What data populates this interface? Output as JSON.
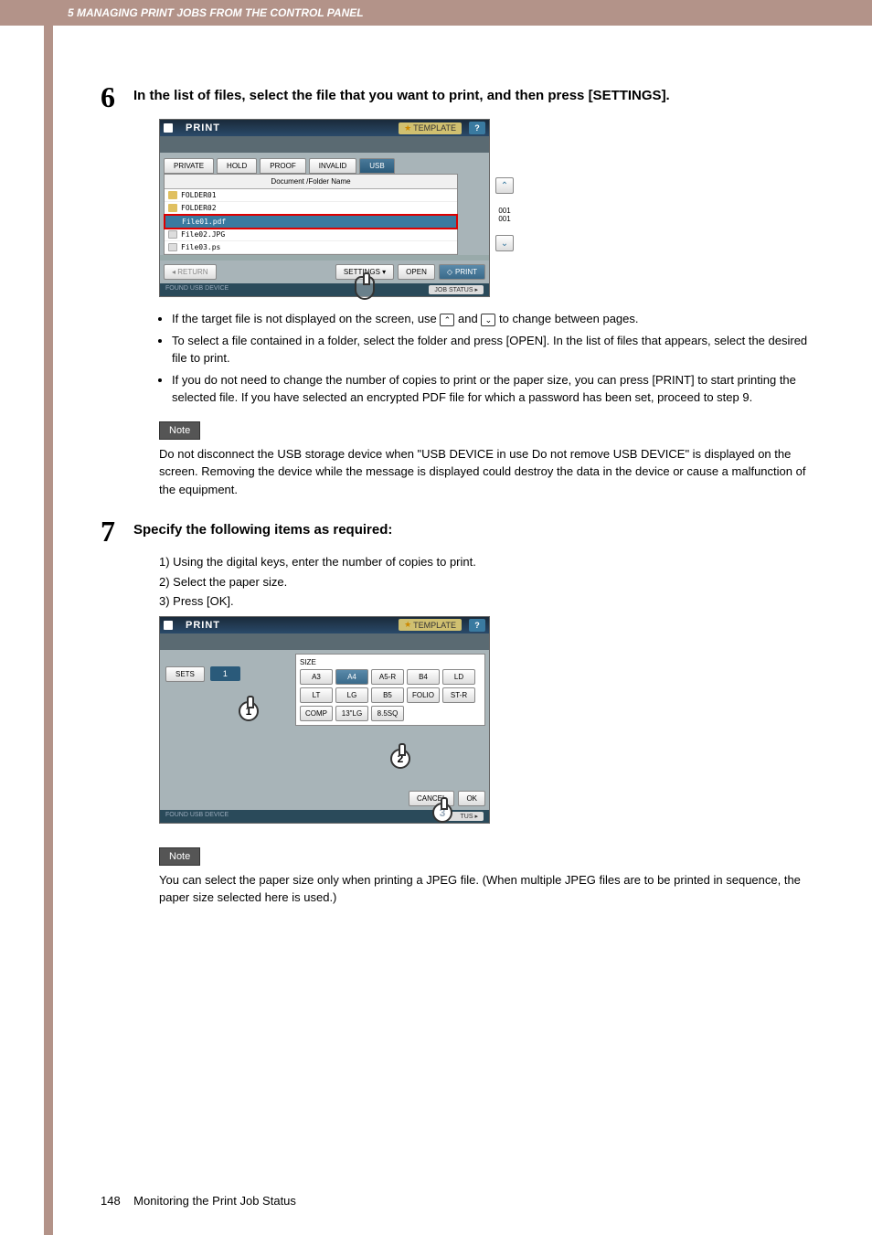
{
  "header": "5 MANAGING PRINT JOBS FROM THE CONTROL PANEL",
  "step6": {
    "num": "6",
    "title": "In the list of files, select the file that you want to print, and then press [SETTINGS].",
    "screen": {
      "title": "PRINT",
      "template": "TEMPLATE",
      "help": "?",
      "tabs": [
        "PRIVATE",
        "HOLD",
        "PROOF",
        "INVALID",
        "USB"
      ],
      "active_tab": "USB",
      "list_header": "Document /Folder Name",
      "files": [
        "FOLDER01",
        "FOLDER02",
        "File01.pdf",
        "File02.JPG",
        "File03.ps"
      ],
      "selected": "File01.pdf",
      "page": "001",
      "page_total": "001",
      "return": "RETURN",
      "settings": "SETTINGS",
      "open": "OPEN",
      "print": "PRINT",
      "status_left": "FOUND USB DEVICE",
      "status_right": "JOB STATUS"
    },
    "bullets": [
      "If the target file is not displayed on the screen, use",
      "and",
      "to change between pages.",
      "To select a file contained in a folder, select the folder and press [OPEN]. In the list of files that appears, select the desired file to print.",
      "If you do not need to change the number of copies to print or the paper size, you can press [PRINT] to start printing the selected file. If you have selected an encrypted PDF file for which a password has been set, proceed to step 9."
    ],
    "note_label": "Note",
    "note": "Do not disconnect the USB storage device when \"USB DEVICE in use Do not remove USB DEVICE\" is displayed on the screen. Removing the device while the message is displayed could destroy the data in the device or cause a malfunction of the equipment."
  },
  "step7": {
    "num": "7",
    "title": "Specify the following items as required:",
    "items": [
      "1)  Using the digital keys, enter the number of copies to print.",
      "2)  Select the paper size.",
      "3)  Press [OK]."
    ],
    "screen": {
      "title": "PRINT",
      "template": "TEMPLATE",
      "help": "?",
      "sets_label": "SETS",
      "sets_value": "1",
      "size_label": "SIZE",
      "sizes": [
        "A3",
        "A4",
        "A5-R",
        "B4",
        "LD",
        "LT",
        "LG",
        "B5",
        "FOLIO",
        "ST-R",
        "COMP",
        "13\"LG",
        "8.5SQ"
      ],
      "size_selected": "A4",
      "cancel": "CANCEL",
      "ok": "OK",
      "status_left": "FOUND USB DEVICE",
      "status_right_suffix": "TUS"
    },
    "note_label": "Note",
    "note": "You can select the paper size only when printing a JPEG file. (When multiple JPEG files are to be printed in sequence, the paper size selected here is used.)"
  },
  "footer": {
    "page": "148",
    "text": "Monitoring the Print Job Status"
  }
}
